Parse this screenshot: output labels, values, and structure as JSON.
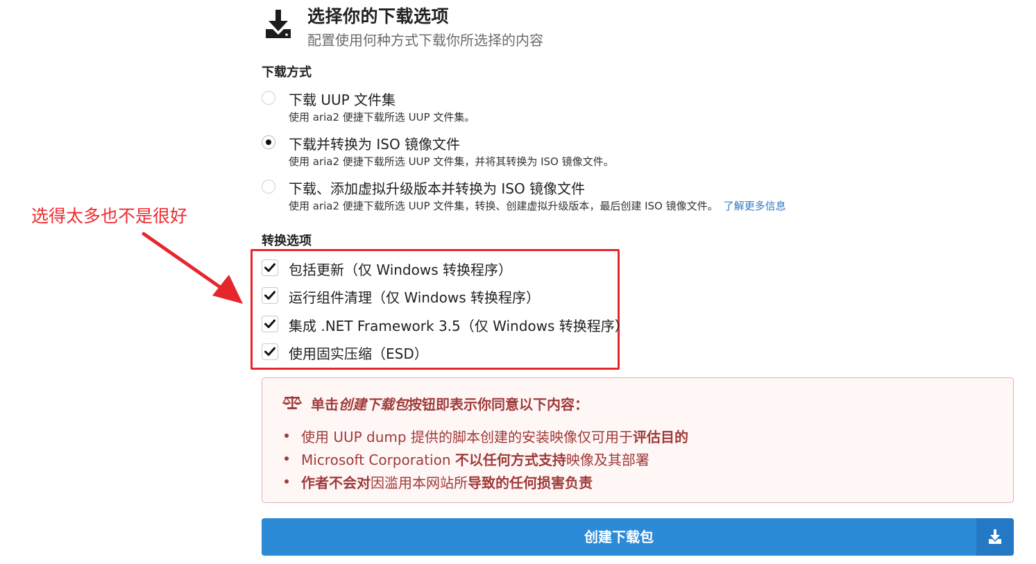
{
  "header": {
    "icon": "download-icon",
    "title": "选择你的下载选项",
    "subtitle": "配置使用何种方式下载你所选择的内容"
  },
  "download_method": {
    "label": "下载方式",
    "options": [
      {
        "title": "下载 UUP 文件集",
        "desc": "使用 aria2 便捷下载所选 UUP 文件集。",
        "selected": false
      },
      {
        "title": "下载并转换为 ISO 镜像文件",
        "desc": "使用 aria2 便捷下载所选 UUP 文件集，并将其转换为 ISO 镜像文件。",
        "selected": true
      },
      {
        "title": "下载、添加虚拟升级版本并转换为 ISO 镜像文件",
        "desc": "使用 aria2 便捷下载所选 UUP 文件集，转换、创建虚拟升级版本，最后创建 ISO 镜像文件。",
        "link": "了解更多信息",
        "selected": false
      }
    ]
  },
  "conversion_options": {
    "label": "转换选项",
    "items": [
      {
        "label": "包括更新（仅 Windows 转换程序）",
        "checked": true
      },
      {
        "label": "运行组件清理（仅 Windows 转换程序）",
        "checked": true
      },
      {
        "label": "集成 .NET Framework 3.5（仅 Windows 转换程序）",
        "checked": true
      },
      {
        "label": "使用固实压缩（ESD）",
        "checked": true
      }
    ]
  },
  "annotation": {
    "text": "选得太多也不是很好",
    "color": "#ef2a2f"
  },
  "notice": {
    "icon": "balance-scale-icon",
    "header_pre": "单击",
    "header_em": "创建下载包",
    "header_post": "按钮即表示你同意以下内容：",
    "items": [
      {
        "pre": "使用 UUP dump 提供的脚本创建的安装映像仅可用于",
        "bold": "评估目的",
        "post": ""
      },
      {
        "pre": "Microsoft Corporation ",
        "bold": "不以任何方式支持",
        "post": "映像及其部署"
      },
      {
        "pre": "",
        "bold": "作者不会对",
        "post": "因滥用本网站所",
        "bold2": "导致的任何损害负责"
      }
    ]
  },
  "create_button": {
    "label": "创建下载包",
    "icon": "download-icon"
  },
  "colors": {
    "accent": "#2c8ad6",
    "notice_text": "#9f3a38",
    "highlight": "#e5262d"
  }
}
